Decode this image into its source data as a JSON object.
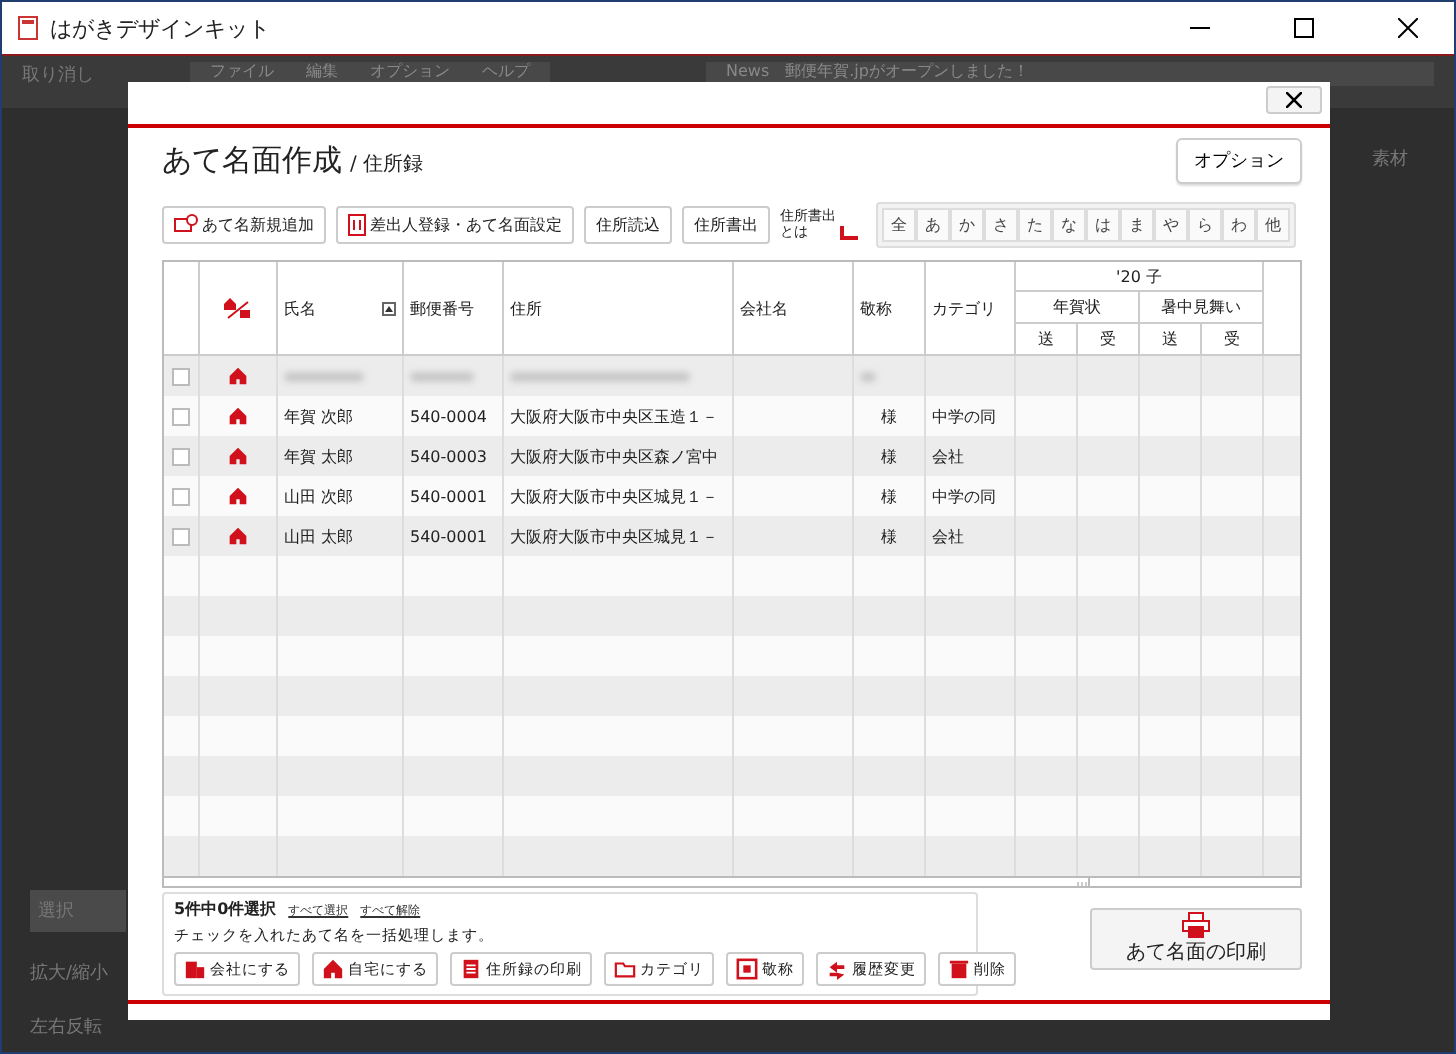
{
  "window": {
    "title": "はがきデザインキット"
  },
  "background": {
    "undo": "取り消し",
    "menu": [
      "ファイル",
      "編集",
      "オプション",
      "ヘルプ"
    ],
    "news_label": "News",
    "news_text": "郵便年賀.jpがオープンしました！",
    "side_tab": "選択",
    "side_items": [
      "拡大/縮小",
      "左右反転"
    ],
    "right_tab": "素材"
  },
  "dialog": {
    "title": "あて名面作成",
    "subtitle": "/ 住所録",
    "option_button": "オプション",
    "toolbar": [
      "あて名新規追加",
      "差出人登録・あて名面設定",
      "住所読込",
      "住所書出"
    ],
    "help_link": "住所書出とは",
    "kana": [
      "全",
      "あ",
      "か",
      "さ",
      "た",
      "な",
      "は",
      "ま",
      "や",
      "ら",
      "わ",
      "他"
    ],
    "table": {
      "columns": [
        "氏名",
        "郵便番号",
        "住所",
        "会社名",
        "敬称",
        "カテゴリ"
      ],
      "year_group": "'20 子",
      "subgroups": [
        "年賀状",
        "暑中見舞い"
      ],
      "sub_columns": [
        "送",
        "受",
        "送",
        "受"
      ],
      "rows": [
        {
          "kind": "blurred",
          "checked": false
        },
        {
          "kind": "entry",
          "checked": false,
          "name": "年賀 次郎",
          "zip": "540-0004",
          "address": "大阪府大阪市中央区玉造１－",
          "honorific": "様",
          "category": "中学の同"
        },
        {
          "kind": "entry",
          "checked": false,
          "name": "年賀 太郎",
          "zip": "540-0003",
          "address": "大阪府大阪市中央区森ノ宮中",
          "honorific": "様",
          "category": "会社"
        },
        {
          "kind": "entry",
          "checked": false,
          "name": "山田 次郎",
          "zip": "540-0001",
          "address": "大阪府大阪市中央区城見１－",
          "honorific": "様",
          "category": "中学の同"
        },
        {
          "kind": "entry",
          "checked": false,
          "name": "山田 太郎",
          "zip": "540-0001",
          "address": "大阪府大阪市中央区城見１－",
          "honorific": "様",
          "category": "会社"
        }
      ]
    },
    "selection": {
      "count": "5件中0件選択",
      "select_all": "すべて選択",
      "clear_all": "すべて解除",
      "hint": "チェックを入れたあて名を一括処理します。"
    },
    "actions": [
      "会社にする",
      "自宅にする",
      "住所録の印刷",
      "カテゴリ",
      "敬称",
      "履歴変更",
      "削除"
    ],
    "print_button": "あて名面の印刷"
  }
}
